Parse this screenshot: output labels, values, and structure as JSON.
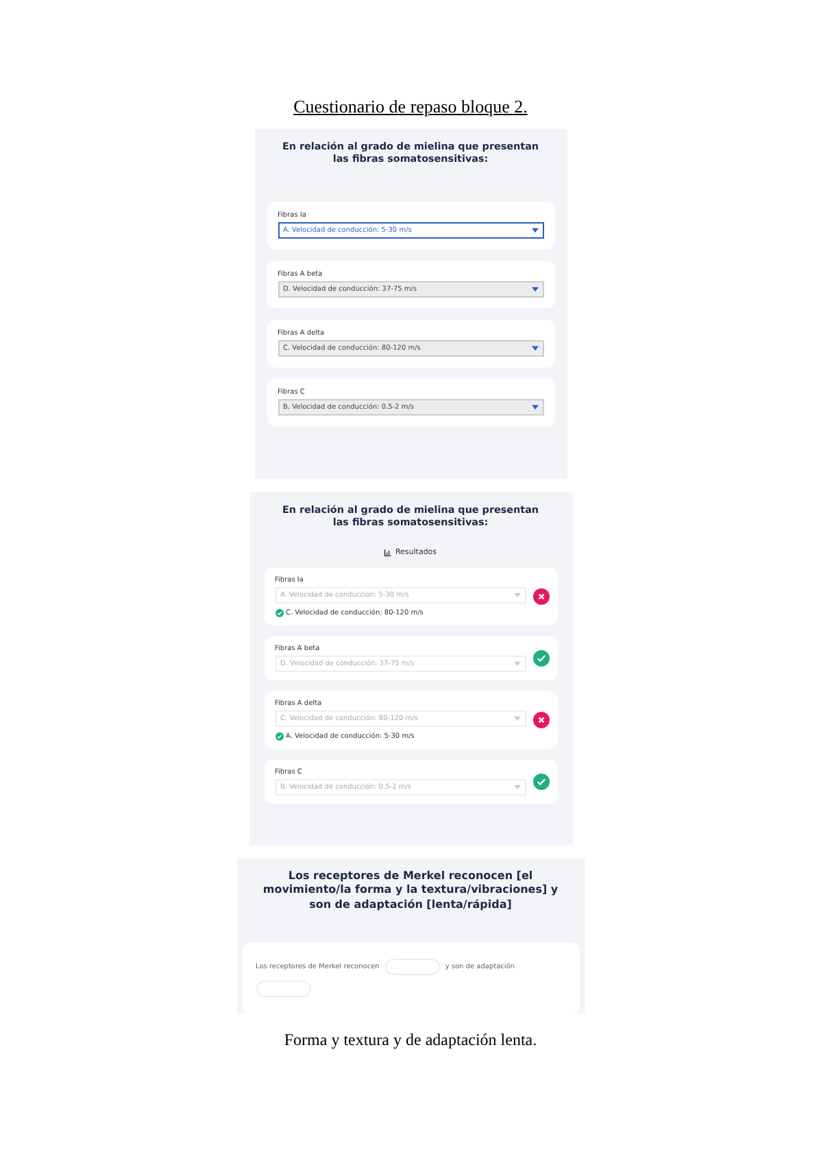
{
  "document_title": "Cuestionario de repaso bloque 2.",
  "quiz": {
    "question": "En relación al grado de mielina que presentan las fibras somatosensitivas:",
    "items": [
      {
        "label": "Fibras Ia",
        "value": "A. Velocidad de conducción: 5-30 m/s",
        "focused": true
      },
      {
        "label": "Fibras A beta",
        "value": "D. Velocidad de conducción: 37-75 m/s",
        "focused": false
      },
      {
        "label": "Fibras A delta",
        "value": "C. Velocidad de conducción: 80-120 m/s",
        "focused": false
      },
      {
        "label": "Fibras C",
        "value": "B. Velocidad de conducción: 0.5-2 m/s",
        "focused": false
      }
    ]
  },
  "results": {
    "question": "En relación al grado de mielina que presentan las fibras somatosensitivas:",
    "heading": "Resultados",
    "items": [
      {
        "label": "Fibras Ia",
        "value": "A. Velocidad de conducción: 5-30 m/s",
        "correct": false,
        "correct_answer": "C. Velocidad de conducción: 80-120 m/s"
      },
      {
        "label": "Fibras A beta",
        "value": "D. Velocidad de conducción: 37-75 m/s",
        "correct": true
      },
      {
        "label": "Fibras A delta",
        "value": "C. Velocidad de conducción: 80-120 m/s",
        "correct": false,
        "correct_answer": "A. Velocidad de conducción: 5-30 m/s"
      },
      {
        "label": "Fibras C",
        "value": "B. Velocidad de conducción: 0.5-2 m/s",
        "correct": true
      }
    ]
  },
  "fill_in": {
    "question": "Los receptores de Merkel reconocen [el movimiento/la forma y la textura/vibraciones] y son de adaptación [lenta/rápida]",
    "sentence_parts": [
      "Los receptores de Merkel reconocen",
      "y son de adaptación"
    ]
  },
  "answer": "Forma y textura y de adaptación lenta."
}
